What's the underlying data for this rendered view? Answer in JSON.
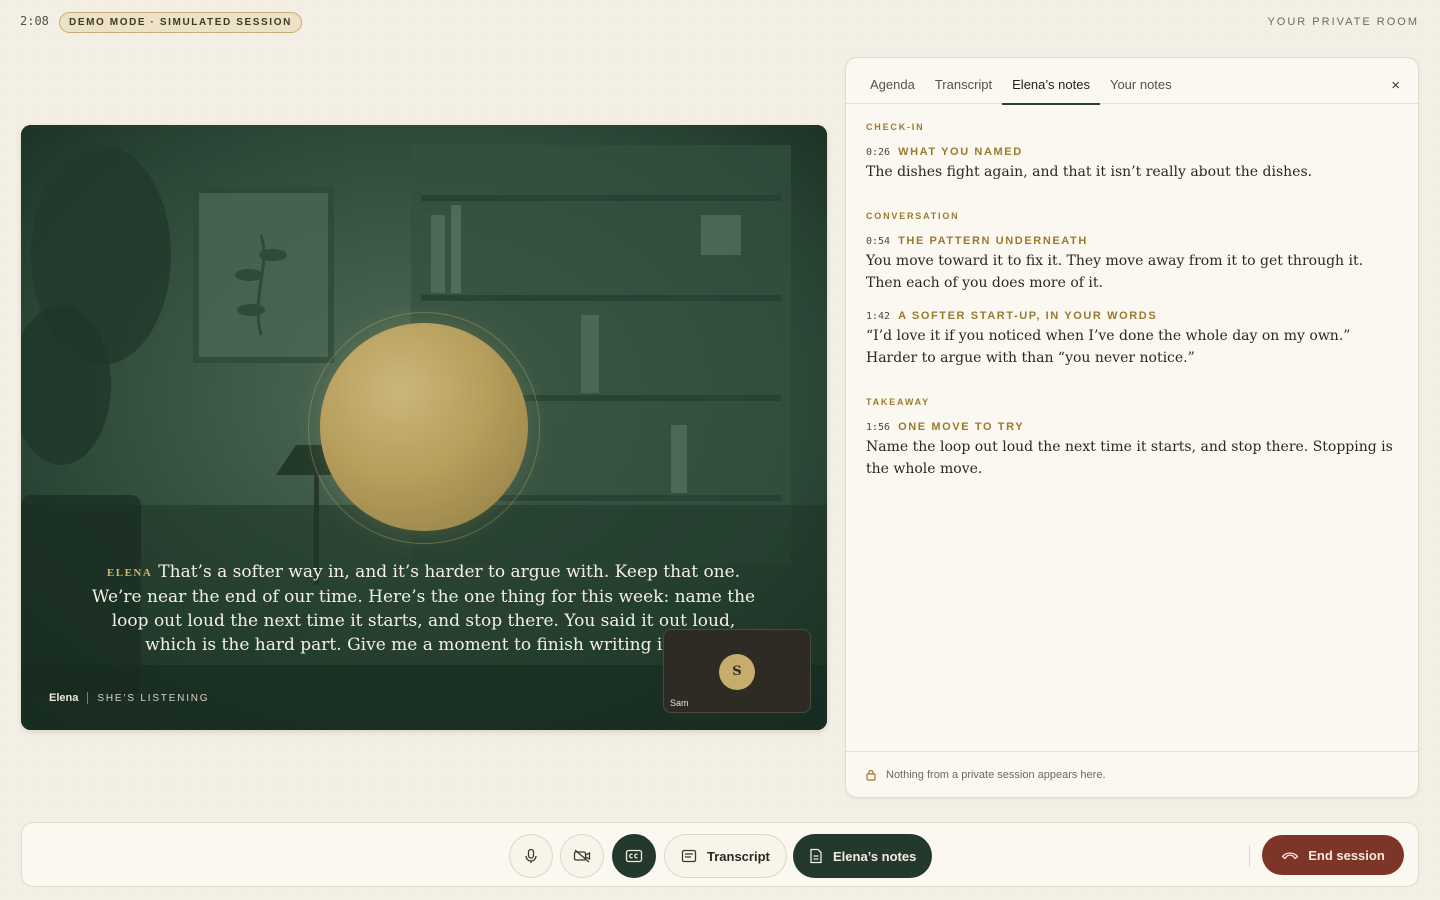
{
  "header": {
    "time": "2:08",
    "demo_badge": "DEMO MODE · SIMULATED SESSION",
    "room_label": "YOUR PRIVATE ROOM"
  },
  "stage": {
    "caption_speaker": "ELENA",
    "caption_text": "That’s a softer way in, and it’s harder to argue with. Keep that one. We’re near the end of our time. Here’s the one thing for this week: name the loop out loud the next time it starts, and stop there. You said it out loud, which is the hard part. Give me a moment to finish writing it up.",
    "host_name": "Elena",
    "host_status": "SHE’S LISTENING",
    "self_initial": "S",
    "self_name": "Sam"
  },
  "panel": {
    "tabs": [
      "Agenda",
      "Transcript",
      "Elena’s notes",
      "Your notes"
    ],
    "active_tab": "Elena’s notes",
    "close_label": "×",
    "sections": [
      {
        "title": "CHECK-IN",
        "notes": [
          {
            "time": "0:26",
            "title": "WHAT YOU NAMED",
            "body": "The dishes fight again, and that it isn’t really about the dishes."
          }
        ]
      },
      {
        "title": "CONVERSATION",
        "notes": [
          {
            "time": "0:54",
            "title": "THE PATTERN UNDERNEATH",
            "body": "You move toward it to fix it. They move away from it to get through it. Then each of you does more of it."
          },
          {
            "time": "1:42",
            "title": "A SOFTER START-UP, IN YOUR WORDS",
            "body": "“I’d love it if you noticed when I’ve done the whole day on my own.” Harder to argue with than “you never notice.”"
          }
        ]
      },
      {
        "title": "TAKEAWAY",
        "notes": [
          {
            "time": "1:56",
            "title": "ONE MOVE TO TRY",
            "body": "Name the loop out loud the next time it starts, and stop there. Stopping is the whole move."
          }
        ]
      }
    ],
    "footer_text": "Nothing from a private session appears here."
  },
  "controls": {
    "mic_icon": "microphone-icon",
    "camera_icon": "camera-off-icon",
    "captions_icon": "captions-icon",
    "transcript_label": "Transcript",
    "notes_label": "Elena’s notes",
    "end_label": "End session"
  },
  "colors": {
    "background": "#f4efe5",
    "accent_dark_green": "#24392d",
    "accent_gold": "#9a7a2e",
    "end_red": "#7d3527",
    "orb_gold": "#b79f5c"
  }
}
